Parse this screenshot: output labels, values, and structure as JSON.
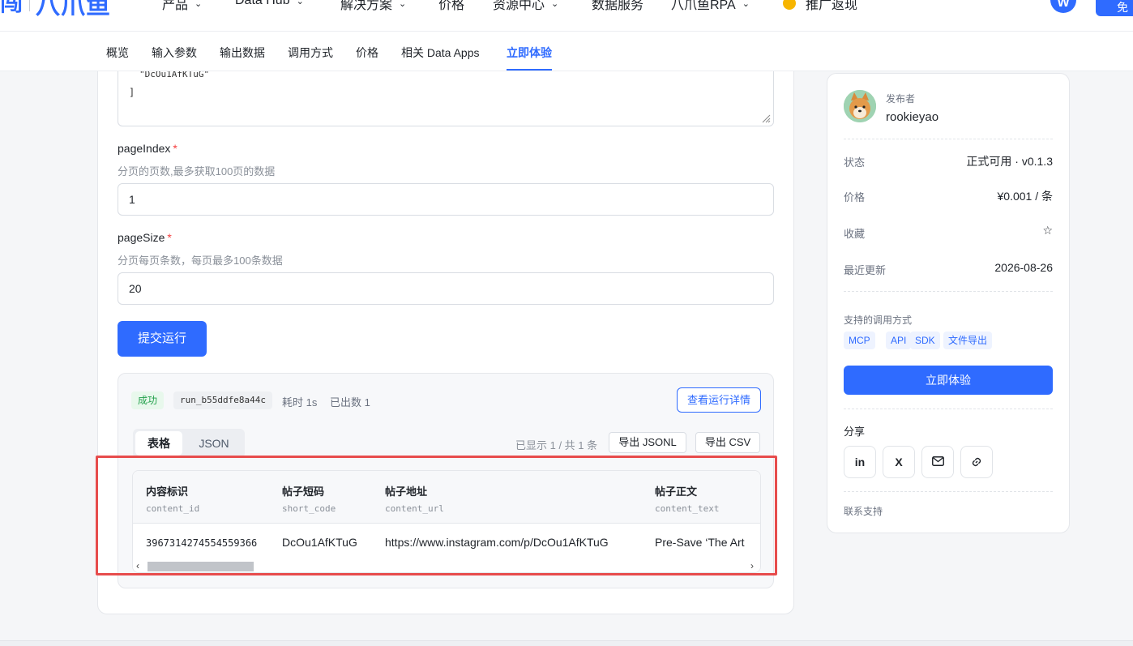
{
  "topnav": {
    "logo_mark": "闯",
    "logo_text": "八爪鱼",
    "items": [
      {
        "label": "产品",
        "has_menu": true
      },
      {
        "label": "Data Hub",
        "has_menu": true
      },
      {
        "label": "解决方案",
        "has_menu": true
      },
      {
        "label": "价格",
        "has_menu": false
      },
      {
        "label": "资源中心",
        "has_menu": true
      },
      {
        "label": "数据服务",
        "has_menu": false
      },
      {
        "label": "八爪鱼RPA",
        "has_menu": true
      },
      {
        "label": "推广返现",
        "has_menu": false
      }
    ],
    "avatar_initial": "W",
    "cta_label": "免"
  },
  "tabs": [
    {
      "label": "概览"
    },
    {
      "label": "输入参数"
    },
    {
      "label": "输出数据"
    },
    {
      "label": "调用方式"
    },
    {
      "label": "价格"
    },
    {
      "label": "相关 Data Apps"
    },
    {
      "label": "立即体验",
      "active": true
    }
  ],
  "form": {
    "textarea_line1": "\"DcOu1AfKTuG\"",
    "textarea_line2": "]",
    "page_index": {
      "label": "pageIndex",
      "required_mark": "*",
      "hint": "分页的页数,最多获取100页的数据",
      "value": "1"
    },
    "page_size": {
      "label": "pageSize",
      "required_mark": "*",
      "hint": "分页每页条数，每页最多100条数据",
      "value": "20"
    },
    "submit_label": "提交运行"
  },
  "result": {
    "status": "成功",
    "run_id": "run_b55ddfe8a44c",
    "elapsed": "耗时 1s",
    "output_count": "已出数 1",
    "detail_button": "查看运行详情",
    "view_tabs": [
      "表格",
      "JSON"
    ],
    "shown_text": "已显示 1 / 共 1 条",
    "export_jsonl": "导出 JSONL",
    "export_csv": "导出 CSV",
    "columns": [
      {
        "cn": "内容标识",
        "en": "content_id"
      },
      {
        "cn": "帖子短码",
        "en": "short_code"
      },
      {
        "cn": "帖子地址",
        "en": "content_url"
      },
      {
        "cn": "帖子正文",
        "en": "content_text"
      }
    ],
    "rows": [
      [
        "3967314274554559366",
        "DcOu1AfKTuG",
        "https://www.instagram.com/p/DcOu1AfKTuG",
        "Pre-Save   ‘The Art"
      ]
    ]
  },
  "side": {
    "publisher_label": "发布者",
    "publisher_name": "rookieyao",
    "status_label": "状态",
    "status_value": "正式可用 · v0.1.3",
    "price_label": "价格",
    "price_value": "¥0.001 / 条",
    "fav_label": "收藏",
    "fav_value": "☆",
    "updated_label": "最近更新",
    "updated_value": "2026-08-26",
    "methods_title": "支持的调用方式",
    "methods": [
      "MCP",
      "API",
      "SDK",
      "文件导出"
    ],
    "try_button": "立即体验",
    "share_title": "分享",
    "share": [
      {
        "icon": "linkedin-icon",
        "text": "in"
      },
      {
        "icon": "x-icon",
        "text": "X"
      },
      {
        "icon": "mail-icon",
        "text": ""
      },
      {
        "icon": "link-icon",
        "text": ""
      }
    ],
    "support_label": "联系支持"
  },
  "colors": {
    "accent": "#2f6bff",
    "success": "#22a04b",
    "highlight": "#e74c4c"
  }
}
